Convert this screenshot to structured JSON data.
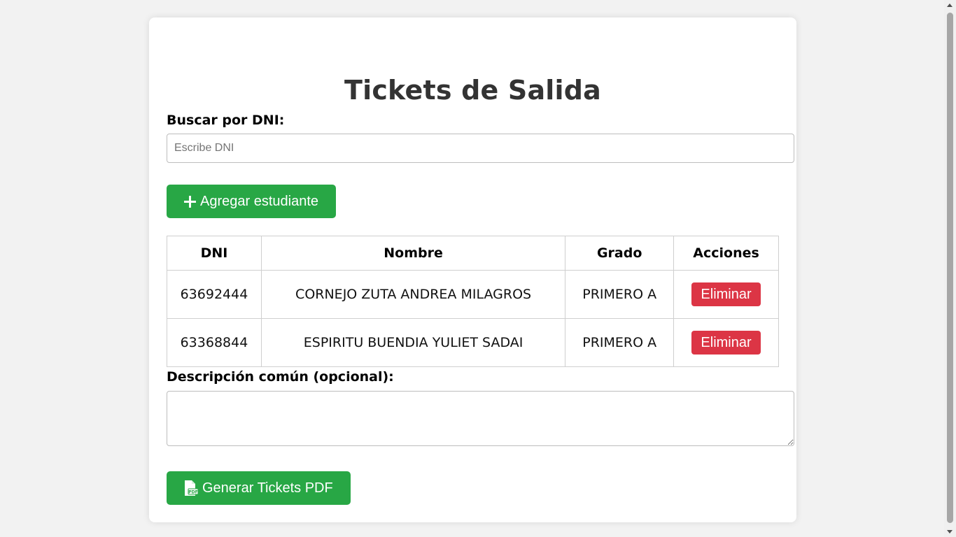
{
  "page": {
    "title": "Tickets de Salida"
  },
  "search": {
    "label": "Buscar por DNI:",
    "placeholder": "Escribe DNI",
    "value": ""
  },
  "add_button": {
    "icon": "plus-icon",
    "label": "Agregar estudiante"
  },
  "table": {
    "headers": [
      "DNI",
      "Nombre",
      "Grado",
      "Acciones"
    ],
    "rows": [
      {
        "dni": "63692444",
        "nombre": "CORNEJO ZUTA ANDREA MILAGROS",
        "grado": "PRIMERO A",
        "action": "Eliminar"
      },
      {
        "dni": "63368844",
        "nombre": "ESPIRITU BUENDIA YULIET SADAI",
        "grado": "PRIMERO A",
        "action": "Eliminar"
      }
    ]
  },
  "description": {
    "label": "Descripción común (opcional):",
    "value": ""
  },
  "generate_button": {
    "icon": "pdf-file-icon",
    "label": "Generar Tickets PDF"
  },
  "colors": {
    "page_bg": "#f2f2f2",
    "card_bg": "#ffffff",
    "primary_green": "#28a745",
    "danger_red": "#dc3545",
    "title_text": "#333333"
  }
}
